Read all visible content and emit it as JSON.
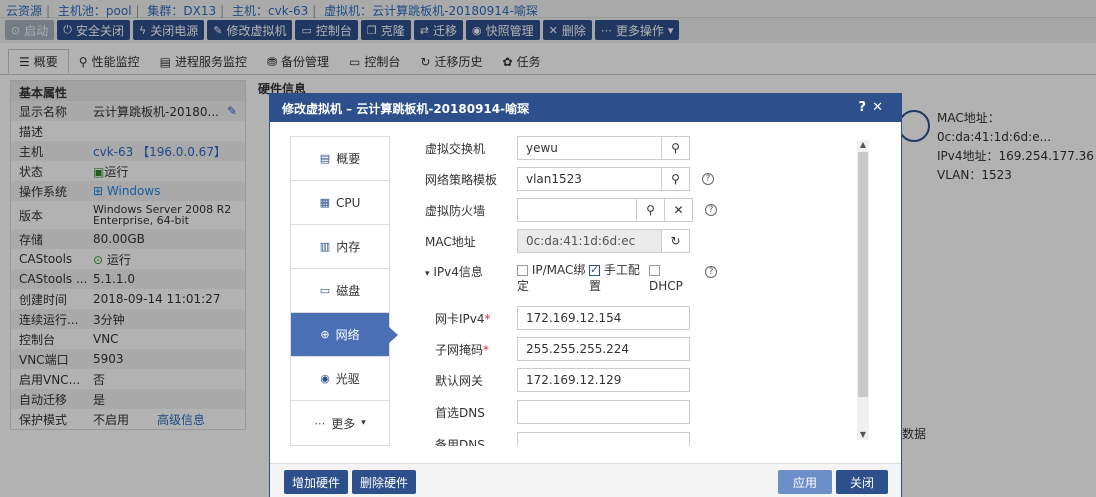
{
  "breadcrumb": [
    "云资源",
    "主机池：pool",
    "集群：DX13",
    "主机：cvk-63",
    "虚拟机：云计算跳板机-20180914-喻琛"
  ],
  "toolbar": {
    "start": "启动",
    "safe_shutdown": "安全关闭",
    "power_off": "关闭电源",
    "modify_vm": "修改虚拟机",
    "console": "控制台",
    "clone": "克隆",
    "migrate": "迁移",
    "snapshot": "快照管理",
    "delete": "删除",
    "more": "更多操作"
  },
  "tabs": [
    "概要",
    "性能监控",
    "进程服务监控",
    "备份管理",
    "控制台",
    "迁移历史",
    "任务"
  ],
  "props": {
    "header": "基本属性",
    "rows": [
      {
        "k": "显示名称",
        "v": "云计算跳板机-20180..."
      },
      {
        "k": "描述",
        "v": ""
      },
      {
        "k": "主机",
        "v": "cvk-63 【196.0.0.67】"
      },
      {
        "k": "状态",
        "v": "运行"
      },
      {
        "k": "操作系统",
        "v": "Windows"
      },
      {
        "k": "版本",
        "v": "Windows Server 2008 R2 Enterprise, 64-bit"
      },
      {
        "k": "存储",
        "v": "80.00GB"
      },
      {
        "k": "CAStools",
        "v": "运行"
      },
      {
        "k": "CAStools ...",
        "v": "5.1.1.0"
      },
      {
        "k": "创建时间",
        "v": "2018-09-14 11:01:27"
      },
      {
        "k": "连续运行...",
        "v": "3分钟"
      },
      {
        "k": "控制台",
        "v": "VNC"
      },
      {
        "k": "VNC端口",
        "v": "5903"
      },
      {
        "k": "启用VNC...",
        "v": "否"
      },
      {
        "k": "自动迁移",
        "v": "是"
      },
      {
        "k": "保护模式",
        "v": "不启用"
      }
    ],
    "advanced": "高级信息"
  },
  "hw_title": "硬件信息",
  "net_card": {
    "mac": "MAC地址：",
    "mac_value": "0c:da:41:1d:6d:e...",
    "ipv4": "IPv4地址：169.254.177.36",
    "vlan": "VLAN：1523"
  },
  "bg_data": "数据",
  "dialog": {
    "title": "修改虚拟机 – 云计算跳板机-20180914-喻琛",
    "nav": [
      "概要",
      "CPU",
      "内存",
      "磁盘",
      "网络",
      "光驱",
      "更多"
    ],
    "active_nav": "网络",
    "form": {
      "vswitch_label": "虚拟交换机",
      "vswitch_value": "yewu",
      "policy_label": "网络策略模板",
      "policy_value": "vlan1523",
      "firewall_label": "虚拟防火墙",
      "firewall_value": "",
      "mac_label": "MAC地址",
      "mac_value": "0c:da:41:1d:6d:ec",
      "ipv4_label": "IPv4信息",
      "bind_label": "IP/MAC绑定",
      "manual_label": "手工配置",
      "dhcp_label": "DHCP",
      "ip_label": "网卡IPv4",
      "ip_value": "172.169.12.154",
      "mask_label": "子网掩码",
      "mask_value": "255.255.255.224",
      "gw_label": "默认网关",
      "gw_value": "172.169.12.129",
      "dns1_label": "首选DNS",
      "dns1_value": "",
      "dns2_label": "备用DNS",
      "dns2_value": ""
    },
    "footer": {
      "add_hw": "增加硬件",
      "del_hw": "删除硬件",
      "apply": "应用",
      "close": "关闭"
    }
  },
  "colors": {
    "primary": "#2d4f8b",
    "active_nav": "#4a6fb5",
    "link": "#2a6bbf"
  }
}
